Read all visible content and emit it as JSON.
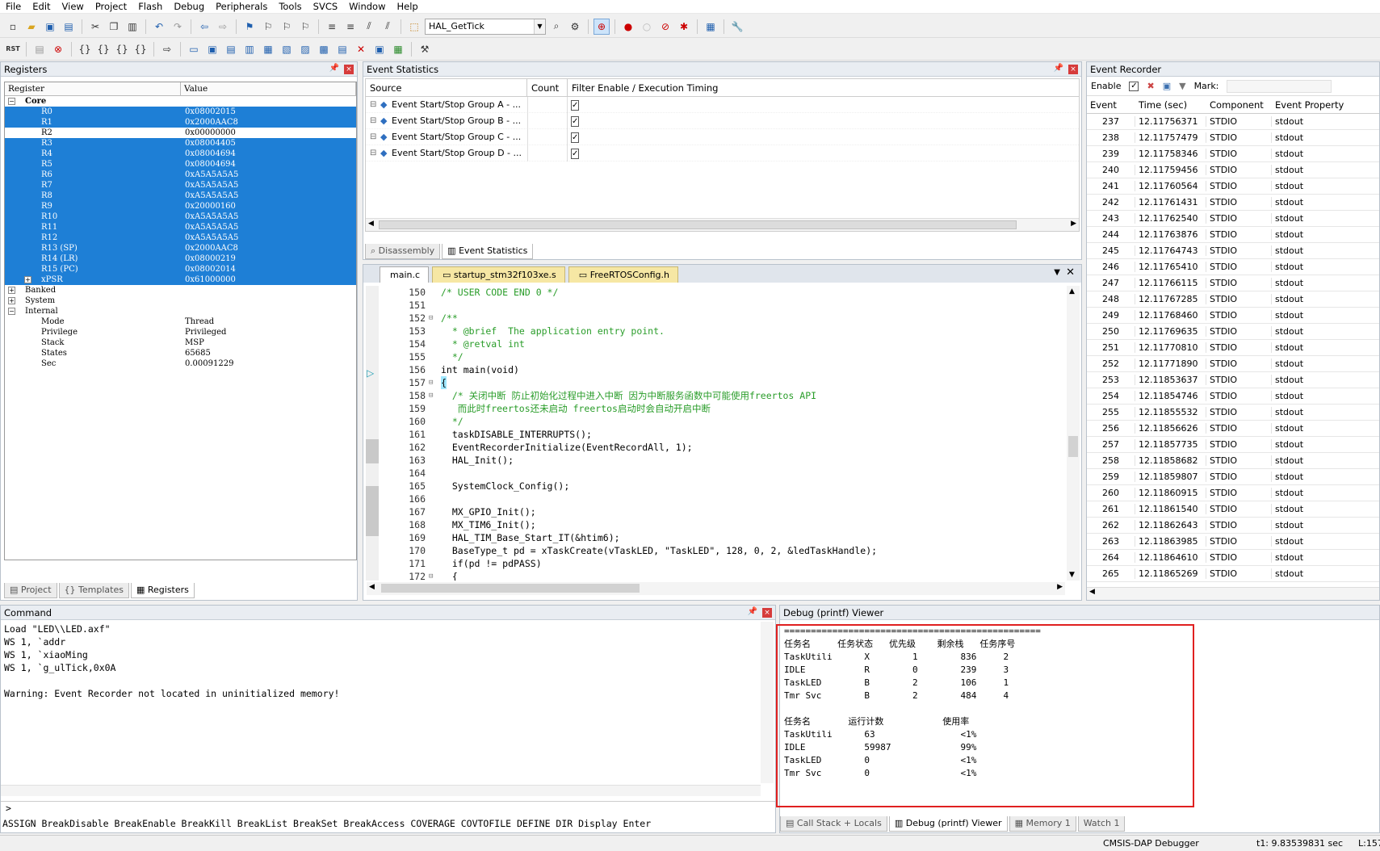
{
  "menu": [
    "File",
    "Edit",
    "View",
    "Project",
    "Flash",
    "Debug",
    "Peripherals",
    "Tools",
    "SVCS",
    "Window",
    "Help"
  ],
  "toolbar": {
    "search_combo": "HAL_GetTick",
    "rst_label": "RST"
  },
  "registers": {
    "title": "Registers",
    "col_register": "Register",
    "col_value": "Value",
    "core_label": "Core",
    "rows": [
      {
        "name": "R0",
        "value": "0x08002015"
      },
      {
        "name": "R1",
        "value": "0x2000AAC8"
      },
      {
        "name": "R2",
        "value": "0x00000000"
      },
      {
        "name": "R3",
        "value": "0x08004405"
      },
      {
        "name": "R4",
        "value": "0x08004694"
      },
      {
        "name": "R5",
        "value": "0x08004694"
      },
      {
        "name": "R6",
        "value": "0xA5A5A5A5"
      },
      {
        "name": "R7",
        "value": "0xA5A5A5A5"
      },
      {
        "name": "R8",
        "value": "0xA5A5A5A5"
      },
      {
        "name": "R9",
        "value": "0x20000160"
      },
      {
        "name": "R10",
        "value": "0xA5A5A5A5"
      },
      {
        "name": "R11",
        "value": "0xA5A5A5A5"
      },
      {
        "name": "R12",
        "value": "0xA5A5A5A5"
      },
      {
        "name": "R13 (SP)",
        "value": "0x2000AAC8"
      },
      {
        "name": "R14 (LR)",
        "value": "0x08000219"
      },
      {
        "name": "R15 (PC)",
        "value": "0x08002014"
      },
      {
        "name": "xPSR",
        "value": "0x61000000"
      }
    ],
    "banked_label": "Banked",
    "system_label": "System",
    "internal_label": "Internal",
    "internal": [
      {
        "name": "Mode",
        "value": "Thread"
      },
      {
        "name": "Privilege",
        "value": "Privileged"
      },
      {
        "name": "Stack",
        "value": "MSP"
      },
      {
        "name": "States",
        "value": "65685"
      },
      {
        "name": "Sec",
        "value": "0.00091229"
      }
    ],
    "tabs": [
      "Project",
      "Templates",
      "Registers"
    ]
  },
  "event_stats": {
    "title": "Event Statistics",
    "col_source": "Source",
    "col_count": "Count",
    "col_filter": "Filter Enable / Execution Timing",
    "rows": [
      "Event Start/Stop Group A - ...",
      "Event Start/Stop Group B - ...",
      "Event Start/Stop Group C - ...",
      "Event Start/Stop Group D - ..."
    ],
    "tabs": [
      "Disassembly",
      "Event Statistics"
    ]
  },
  "recorder": {
    "title": "Event Recorder",
    "enable_label": "Enable",
    "mark_label": "Mark:",
    "cols": [
      "Event",
      "Time (sec)",
      "Component",
      "Event Property"
    ],
    "rows": [
      [
        "237",
        "12.11756371",
        "STDIO",
        "stdout"
      ],
      [
        "238",
        "12.11757479",
        "STDIO",
        "stdout"
      ],
      [
        "239",
        "12.11758346",
        "STDIO",
        "stdout"
      ],
      [
        "240",
        "12.11759456",
        "STDIO",
        "stdout"
      ],
      [
        "241",
        "12.11760564",
        "STDIO",
        "stdout"
      ],
      [
        "242",
        "12.11761431",
        "STDIO",
        "stdout"
      ],
      [
        "243",
        "12.11762540",
        "STDIO",
        "stdout"
      ],
      [
        "244",
        "12.11763876",
        "STDIO",
        "stdout"
      ],
      [
        "245",
        "12.11764743",
        "STDIO",
        "stdout"
      ],
      [
        "246",
        "12.11765410",
        "STDIO",
        "stdout"
      ],
      [
        "247",
        "12.11766115",
        "STDIO",
        "stdout"
      ],
      [
        "248",
        "12.11767285",
        "STDIO",
        "stdout"
      ],
      [
        "249",
        "12.11768460",
        "STDIO",
        "stdout"
      ],
      [
        "250",
        "12.11769635",
        "STDIO",
        "stdout"
      ],
      [
        "251",
        "12.11770810",
        "STDIO",
        "stdout"
      ],
      [
        "252",
        "12.11771890",
        "STDIO",
        "stdout"
      ],
      [
        "253",
        "12.11853637",
        "STDIO",
        "stdout"
      ],
      [
        "254",
        "12.11854746",
        "STDIO",
        "stdout"
      ],
      [
        "255",
        "12.11855532",
        "STDIO",
        "stdout"
      ],
      [
        "256",
        "12.11856626",
        "STDIO",
        "stdout"
      ],
      [
        "257",
        "12.11857735",
        "STDIO",
        "stdout"
      ],
      [
        "258",
        "12.11858682",
        "STDIO",
        "stdout"
      ],
      [
        "259",
        "12.11859807",
        "STDIO",
        "stdout"
      ],
      [
        "260",
        "12.11860915",
        "STDIO",
        "stdout"
      ],
      [
        "261",
        "12.11861540",
        "STDIO",
        "stdout"
      ],
      [
        "262",
        "12.11862643",
        "STDIO",
        "stdout"
      ],
      [
        "263",
        "12.11863985",
        "STDIO",
        "stdout"
      ],
      [
        "264",
        "12.11864610",
        "STDIO",
        "stdout"
      ],
      [
        "265",
        "12.11865269",
        "STDIO",
        "stdout"
      ]
    ]
  },
  "editor": {
    "tabs": [
      "main.c",
      "startup_stm32f103xe.s",
      "FreeRTOSConfig.h"
    ],
    "lines": [
      {
        "n": "150",
        "t": "/* USER CODE END 0 */",
        "c": "cm",
        "i": 0
      },
      {
        "n": "151",
        "t": "",
        "c": "",
        "i": 0
      },
      {
        "n": "152",
        "t": "/**",
        "c": "cm",
        "i": 0
      },
      {
        "n": "153",
        "t": "  * @brief  The application entry point.",
        "c": "cm",
        "i": 0
      },
      {
        "n": "154",
        "t": "  * @retval int",
        "c": "cm",
        "i": 0
      },
      {
        "n": "155",
        "t": "  */",
        "c": "cm",
        "i": 0
      },
      {
        "n": "156",
        "t": "int main(void)",
        "c": "",
        "i": 0
      },
      {
        "n": "157",
        "t": "{",
        "c": "",
        "i": 0
      },
      {
        "n": "158",
        "t": "  /* 关闭中断 防止初始化过程中进入中断 因为中断服务函数中可能使用freertos API",
        "c": "cm",
        "i": 0
      },
      {
        "n": "159",
        "t": "   而此时freertos还未启动 freertos启动时会自动开启中断",
        "c": "cm",
        "i": 0
      },
      {
        "n": "160",
        "t": "  */",
        "c": "cm",
        "i": 0
      },
      {
        "n": "161",
        "t": "  taskDISABLE_INTERRUPTS();",
        "c": "",
        "i": 0
      },
      {
        "n": "162",
        "t": "  EventRecorderInitialize(EventRecordAll, 1);",
        "c": "",
        "i": 0
      },
      {
        "n": "163",
        "t": "  HAL_Init();",
        "c": "",
        "i": 0
      },
      {
        "n": "164",
        "t": "",
        "c": "",
        "i": 0
      },
      {
        "n": "165",
        "t": "  SystemClock_Config();",
        "c": "",
        "i": 0
      },
      {
        "n": "166",
        "t": "",
        "c": "",
        "i": 0
      },
      {
        "n": "167",
        "t": "  MX_GPIO_Init();",
        "c": "",
        "i": 0
      },
      {
        "n": "168",
        "t": "  MX_TIM6_Init();",
        "c": "",
        "i": 0
      },
      {
        "n": "169",
        "t": "  HAL_TIM_Base_Start_IT(&htim6);",
        "c": "",
        "i": 0
      },
      {
        "n": "170",
        "t": "  BaseType_t pd = xTaskCreate(vTaskLED, \"TaskLED\", 128, 0, 2, &ledTaskHandle);",
        "c": "",
        "i": 0
      },
      {
        "n": "171",
        "t": "  if(pd != pdPASS)",
        "c": "",
        "i": 0
      },
      {
        "n": "172",
        "t": "  {",
        "c": "",
        "i": 0
      }
    ]
  },
  "command": {
    "title": "Command",
    "lines": [
      "Load \"LED\\\\LED.axf\"",
      "WS 1, `addr",
      "WS 1, `xiaoMing",
      "WS 1, `g_ulTick,0x0A",
      "",
      "Warning: Event Recorder not located in uninitialized memory!"
    ],
    "prompt": ">",
    "hint": "ASSIGN BreakDisable BreakEnable BreakKill BreakList BreakSet BreakAccess COVERAGE COVTOFILE DEFINE DIR Display Enter"
  },
  "printf": {
    "title": "Debug (printf) Viewer",
    "lines": [
      "================================================",
      "任务名     任务状态   优先级    剩余栈   任务序号",
      "TaskUtili      X        1        836     2",
      "IDLE           R        0        239     3",
      "TaskLED        B        2        106     1",
      "Tmr Svc        B        2        484     4",
      "",
      "任务名       运行计数           使用率",
      "TaskUtili      63                <1%",
      "IDLE           59987             99%",
      "TaskLED        0                 <1%",
      "Tmr Svc        0                 <1%"
    ],
    "tabs": [
      "Call Stack + Locals",
      "Debug (printf) Viewer",
      "Memory 1",
      "Watch 1"
    ]
  },
  "status": {
    "debugger": "CMSIS-DAP Debugger",
    "time": "t1: 9.83539831 sec",
    "line": "L:157"
  },
  "colors": {
    "selection": "#1e7fd6",
    "highlight_box": "#e02020"
  }
}
